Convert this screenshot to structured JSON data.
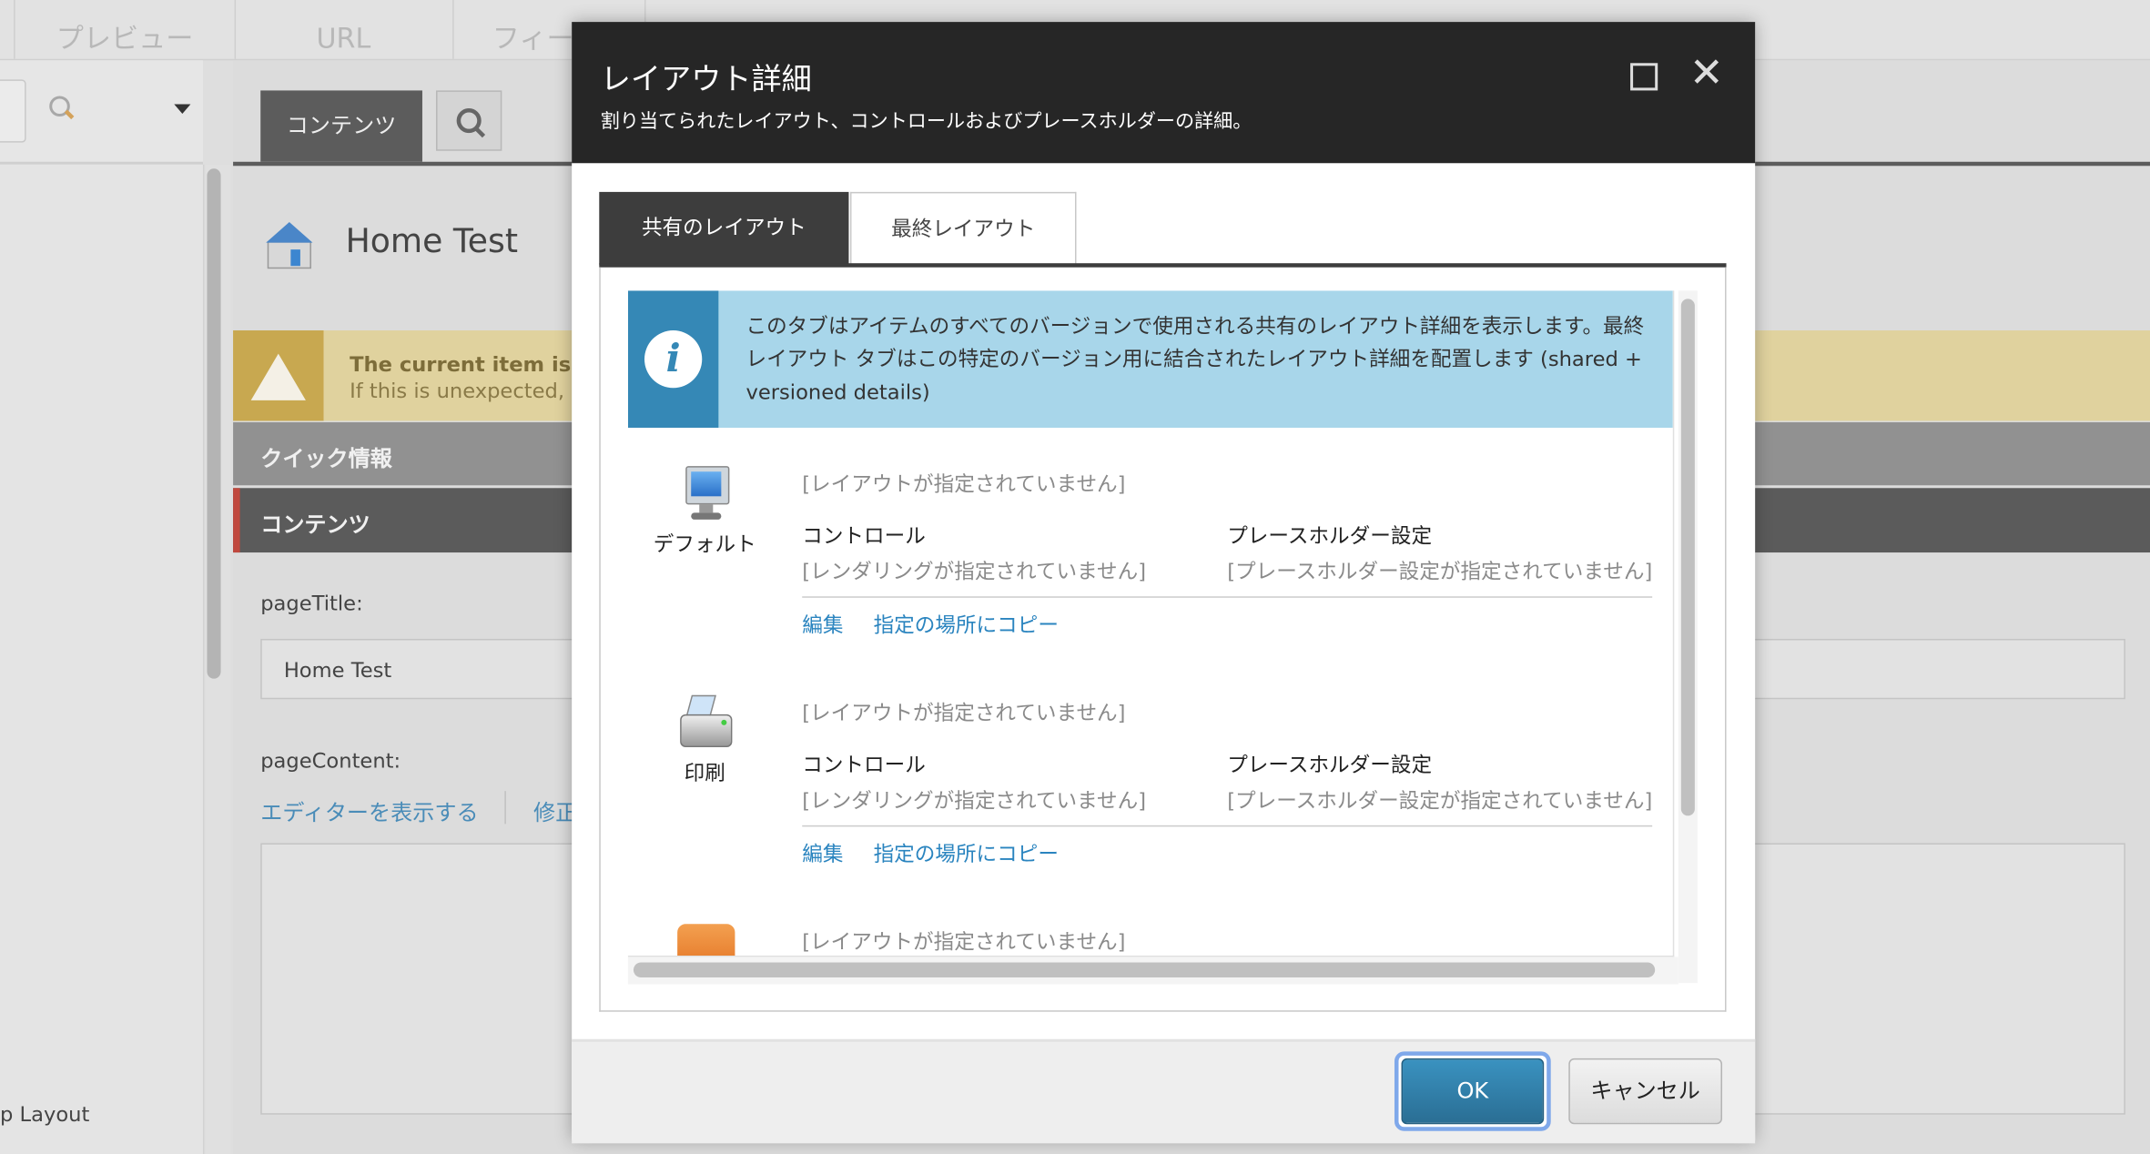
{
  "background": {
    "top_tabs": [
      "プレビュー",
      "URL",
      "フィー"
    ],
    "content_tab": "コンテンツ",
    "item_title": "Home Test",
    "warning": {
      "line1": "The current item is a",
      "line2": "If this is unexpected, p"
    },
    "sections": [
      "クイック情報",
      "コンテンツ"
    ],
    "fields": {
      "page_title_label": "pageTitle:",
      "page_title_value": "Home Test",
      "page_content_label": "pageContent:",
      "show_editor_link": "エディターを表示する",
      "edit_link": "修正"
    },
    "left_panel_footer": "p Layout"
  },
  "dialog": {
    "title": "レイアウト詳細",
    "subtitle": "割り当てられたレイアウト、コントロールおよびプレースホルダーの詳細。",
    "tabs": [
      {
        "label": "共有のレイアウト",
        "active": true
      },
      {
        "label": "最終レイアウト",
        "active": false
      }
    ],
    "info_text": "このタブはアイテムのすべてのバージョンで使用される共有のレイアウト詳細を表示します。最終レイアウト タブはこの特定のバージョン用に結合されたレイアウト詳細を配置します (shared + versioned details)",
    "devices": [
      {
        "name": "デフォルト",
        "icon": "monitor-icon",
        "layout": "[レイアウトが指定されていません]",
        "controls_label": "コントロール",
        "controls_value": "[レンダリングが指定されていません]",
        "placeholder_label": "プレースホルダー設定",
        "placeholder_value": "[プレースホルダー設定が指定されていません]",
        "edit": "編集",
        "copy": "指定の場所にコピー"
      },
      {
        "name": "印刷",
        "icon": "printer-icon",
        "layout": "[レイアウトが指定されていません]",
        "controls_label": "コントロール",
        "controls_value": "[レンダリングが指定されていません]",
        "placeholder_label": "プレースホルダー設定",
        "placeholder_value": "[プレースホルダー設定が指定されていません]",
        "edit": "編集",
        "copy": "指定の場所にコピー"
      },
      {
        "name": "",
        "icon": "rss-icon",
        "layout": "[レイアウトが指定されていません]"
      }
    ],
    "ok": "OK",
    "cancel": "キャンセル"
  },
  "colors": {
    "header": "#262626",
    "info_dark": "#3588b6",
    "info_light": "#a8d6ea",
    "ok": "#2e7fa8",
    "link": "#2a84bf"
  }
}
